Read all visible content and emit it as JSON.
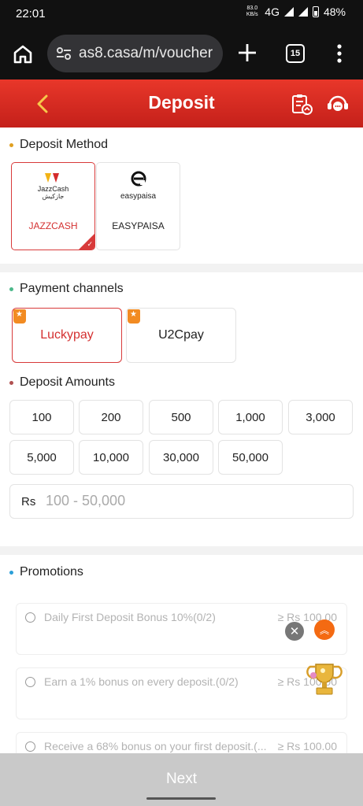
{
  "status_bar": {
    "time": "22:01",
    "net_speed_top": "83.0",
    "net_speed_bottom": "KB/s",
    "network": "4G",
    "battery": "48%"
  },
  "browser": {
    "url": "as8.casa/m/voucher",
    "tab_count": "15"
  },
  "header": {
    "title": "Deposit"
  },
  "deposit_method": {
    "title": "Deposit Method",
    "dot_color": "#e0a020",
    "methods": [
      {
        "label": "JAZZCASH",
        "logo_text": "JazzCash",
        "logo_sub": "جازکیش",
        "selected": true
      },
      {
        "label": "EASYPAISA",
        "logo_text": "easypaisa",
        "selected": false
      }
    ]
  },
  "payment_channels": {
    "title": "Payment channels",
    "dot_color": "#4cb88a",
    "channels": [
      {
        "label": "Luckypay",
        "selected": true
      },
      {
        "label": "U2Cpay",
        "selected": false
      }
    ]
  },
  "deposit_amounts": {
    "title": "Deposit Amounts",
    "dot_color": "#b05050",
    "amounts": [
      "100",
      "200",
      "500",
      "1,000",
      "3,000",
      "5,000",
      "10,000",
      "30,000",
      "50,000"
    ],
    "currency_prefix": "Rs",
    "placeholder": "100 - 50,000"
  },
  "promotions": {
    "title": "Promotions",
    "dot_color": "#2a9fd8",
    "items": [
      {
        "text": "Daily First Deposit Bonus 10%(0/2)",
        "min": "≥ Rs 100.00"
      },
      {
        "text": "Earn a 1% bonus on every deposit.(0/2)",
        "min": "≥ Rs 100.00"
      },
      {
        "text": "Receive a 68% bonus on your first deposit.(...",
        "min": "≥ Rs 100.00"
      }
    ]
  },
  "float": {
    "close_glyph": "✕",
    "top_glyph": "︽"
  },
  "next": {
    "label": "Next"
  },
  "colors": {
    "brand_red": "#d83a3a",
    "accent_orange": "#f46a12"
  }
}
